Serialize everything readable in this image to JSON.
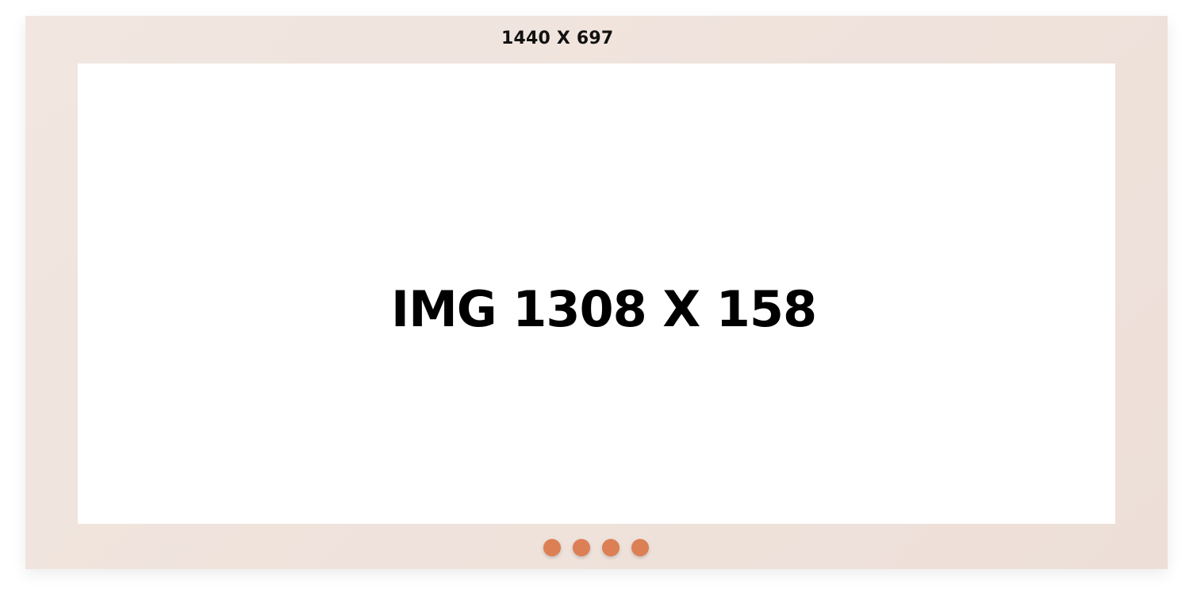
{
  "frame": {
    "label": "1440 X 697",
    "background": "#efe2dc"
  },
  "image_slot": {
    "label": "IMG 1308 X 158",
    "background": "#ffffff"
  },
  "pagination": {
    "count": 4,
    "active_index": 0,
    "dot_color": "#dd7f54"
  }
}
